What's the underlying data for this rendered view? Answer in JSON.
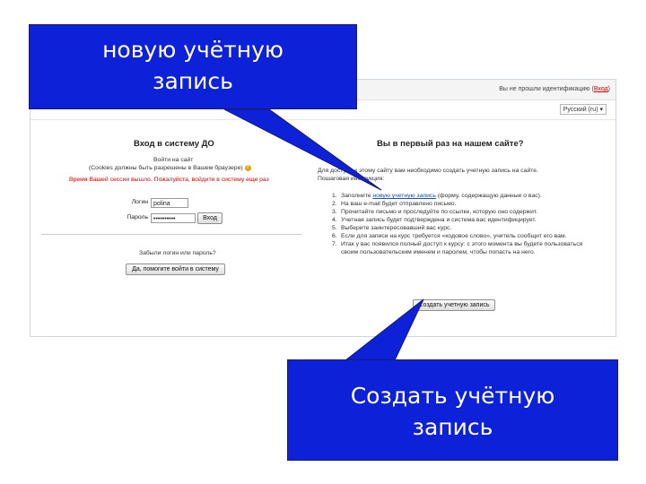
{
  "callouts": {
    "top": {
      "line1": "новую учётную",
      "line2": "запись"
    },
    "bottom": {
      "line1": "Создать учётную",
      "line2": "запись"
    }
  },
  "topbar": {
    "login_status": "Вы не прошли идентификацию",
    "login_link": "Вход"
  },
  "lang_select": {
    "value": "Русский (ru)"
  },
  "login": {
    "heading": "Вход в систему ДО",
    "subtitle": "Войти на сайт",
    "cookies_note": "(Cookies должны быть разрешены в Вашем браузере)",
    "session_expired": "Время Вашей сессии вышло. Пожалуйста, войдите в систему еще раз",
    "username_label": "Логин",
    "username_value": "polina",
    "password_label": "Пароль",
    "password_value": "••••••••••",
    "submit_label": "Вход",
    "forgot_text": "Забыли логин или пароль?",
    "forgot_button": "Да, помогите войти в систему"
  },
  "signup": {
    "heading": "Вы в первый раз на нашем сайте?",
    "intro_line1": "Для доступа к этому сайту вам необходимо создать учетную запись на сайте.",
    "intro_line2": "Пошаговая инструкция:",
    "steps": [
      {
        "num": "1.",
        "before": "Заполните ",
        "link": "новую учетную запись",
        "after": " (форму, содержащую данные о вас)."
      },
      {
        "num": "2.",
        "text": "На ваш e-mail будет отправлено письмо."
      },
      {
        "num": "3.",
        "text": "Прочитайте письмо и проследуйте по ссылке, которую оно содержит."
      },
      {
        "num": "4.",
        "text": "Учетная запись будет подтверждена и система вас идентифицирует."
      },
      {
        "num": "5.",
        "text": "Выберите заинтересовавший вас курс."
      },
      {
        "num": "6.",
        "text": "Если для записи на курс требуется «кодовое слово», учитель сообщит его вам."
      },
      {
        "num": "7.",
        "text": "Итак у вас появился полный доступ к курсу: с этого момента вы будете пользоваться своим пользовательским именем и паролем, чтобы попасть на него."
      }
    ],
    "create_button": "Создать учетную запись"
  }
}
